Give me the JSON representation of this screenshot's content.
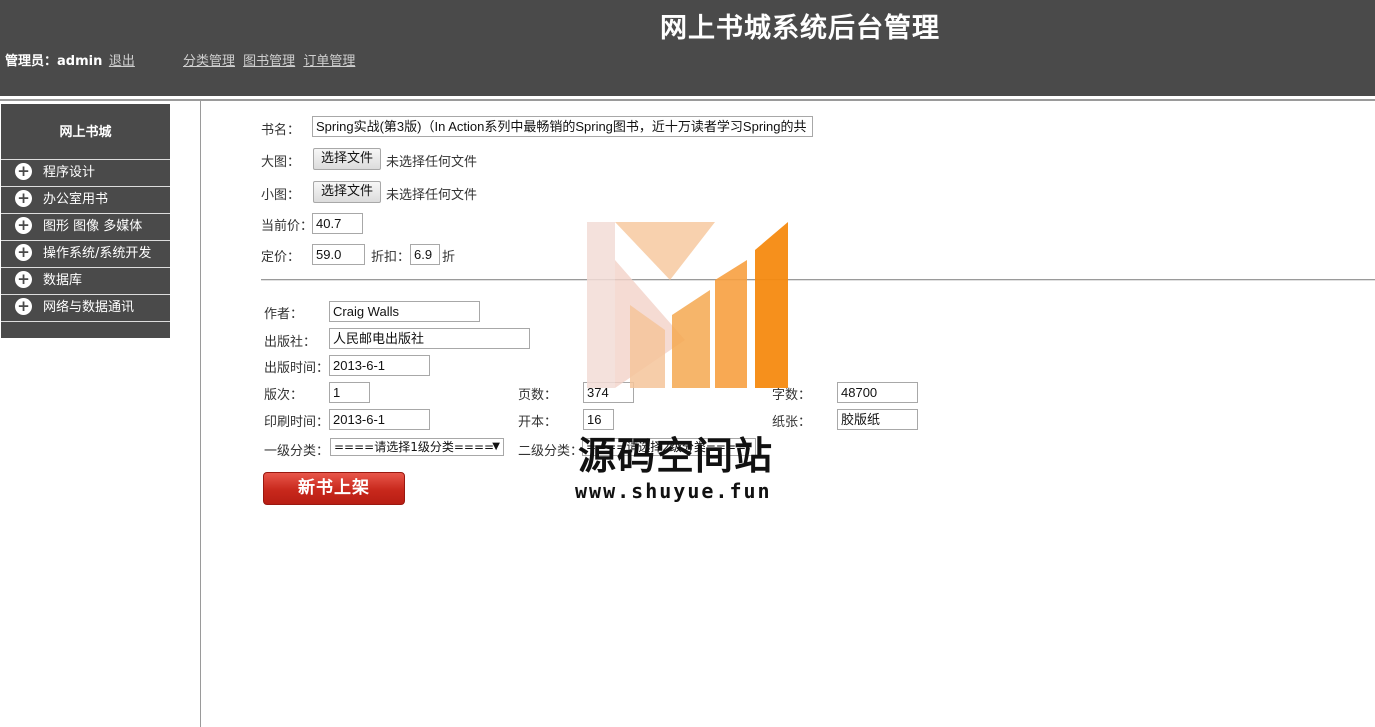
{
  "header": {
    "title": "网上书城系统后台管理",
    "admin_label": "管理员：admin",
    "logout": "退出",
    "nav": [
      "分类管理",
      "图书管理",
      "订单管理"
    ]
  },
  "sidebar": {
    "title": "网上书城",
    "items": [
      "程序设计",
      "办公室用书",
      "图形 图像 多媒体",
      "操作系统/系统开发",
      "数据库",
      "网络与数据通讯"
    ]
  },
  "form": {
    "bookname_label": "书名：",
    "bookname_value": "Spring实战(第3版)（In Action系列中最畅销的Spring图书，近十万读者学习Spring的共",
    "big_image_label": "大图：",
    "small_image_label": "小图：",
    "file_button": "选择文件",
    "file_status": "未选择任何文件",
    "current_price_label": "当前价：",
    "current_price_value": "40.7",
    "list_price_label": "定价：",
    "list_price_value": "59.0",
    "discount_label": "折扣：",
    "discount_value": "6.9",
    "discount_unit": "折",
    "author_label": "作者：",
    "author_value": "Craig Walls",
    "publisher_label": "出版社：",
    "publisher_value": "人民邮电出版社",
    "pubtime_label": "出版时间：",
    "pubtime_value": "2013-6-1",
    "edition_label": "版次：",
    "edition_value": "1",
    "pages_label": "页数：",
    "pages_value": "374",
    "words_label": "字数：",
    "words_value": "48700",
    "printtime_label": "印刷时间：",
    "printtime_value": "2013-6-1",
    "format_label": "开本：",
    "format_value": "16",
    "paper_label": "纸张：",
    "paper_value": "胶版纸",
    "cat1_label": "一级分类：",
    "cat1_value": "====请选择1级分类====",
    "cat2_label": "二级分类：",
    "cat2_value": "====请选择2级分类====",
    "submit": "新书上架"
  },
  "watermark": {
    "text": "源码空间站",
    "url": "www.shuyue.fun"
  }
}
